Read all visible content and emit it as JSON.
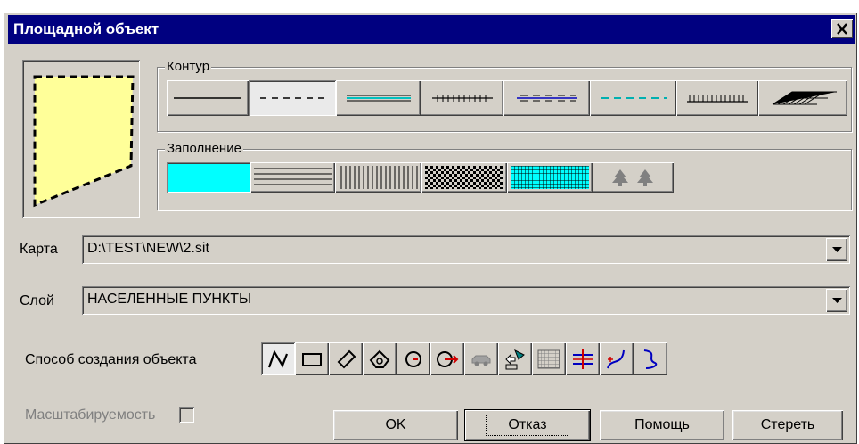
{
  "window": {
    "title": "Площадной объект",
    "close_glyph": "✕"
  },
  "contour": {
    "label": "Контур",
    "styles": [
      "solid",
      "dashed",
      "double",
      "tick",
      "dotted-tick",
      "cyan-dashed",
      "comb",
      "hatch-diagonal"
    ],
    "selected_index": 1
  },
  "fill": {
    "label": "Заполнение",
    "styles": [
      "cyan-solid",
      "horizontal-lines",
      "vertical-lines",
      "checker",
      "cyan-grid",
      "trees"
    ],
    "selected_index": 0
  },
  "map": {
    "label": "Карта",
    "value": "D:\\TEST\\NEW\\2.sit"
  },
  "layer": {
    "label": "Слой",
    "value": "НАСЕЛЕННЫЕ ПУНКТЫ"
  },
  "creation": {
    "label": "Способ создания объекта",
    "methods": [
      "polyline",
      "rectangle",
      "rotated-rectangle",
      "polygon",
      "circle",
      "circle-radius",
      "vehicle",
      "flag-cursor",
      "grid",
      "cross-lines",
      "spline",
      "spline-path"
    ],
    "selected_index": 0
  },
  "scalable": {
    "label": "Масштабируемость",
    "checked": false
  },
  "buttons": {
    "ok": "OK",
    "cancel": "Отказ",
    "help": "Помощь",
    "erase": "Стереть"
  },
  "colors": {
    "title_bar": "#000080",
    "face": "#d4d0c8",
    "preview_fill": "#ffff99",
    "accent_cyan": "#00ffff"
  }
}
